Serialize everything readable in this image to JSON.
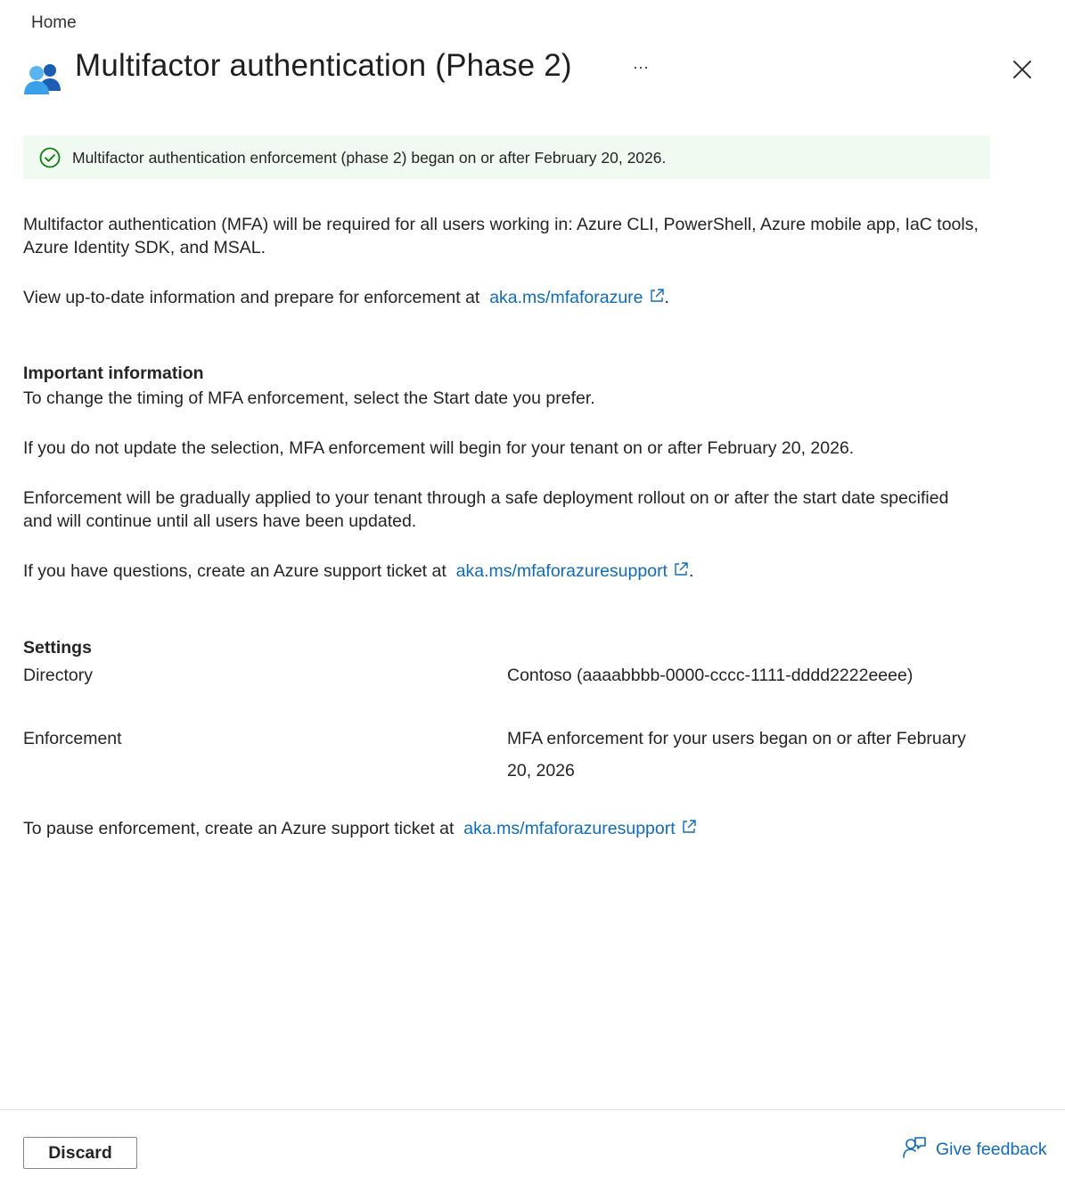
{
  "breadcrumb": {
    "home": "Home"
  },
  "header": {
    "title": "Multifactor authentication (Phase 2)",
    "more": "···",
    "icon": "users-icon"
  },
  "banner": {
    "icon": "check-circle-icon",
    "text": "Multifactor authentication enforcement (phase 2) began on or after February 20, 2026."
  },
  "intro": {
    "p1": "Multifactor authentication (MFA) will be required for all users working in: Azure CLI, PowerShell, Azure mobile app, IaC tools, Azure Identity SDK, and MSAL.",
    "p2_text": "View up-to-date information and prepare for enforcement at",
    "p2_link": "aka.ms/mfaforazure",
    "p2_suffix": "."
  },
  "important": {
    "heading": "Important information",
    "p1": "To change the timing of MFA enforcement, select the Start date you prefer.",
    "p2": "If you do not update the selection, MFA enforcement will begin for your tenant on or after February 20, 2026.",
    "p3": "Enforcement will be gradually applied to your tenant through a safe deployment rollout on or after the start date specified and will continue until all users have been updated.",
    "p4_text": "If you have questions, create an Azure support ticket at",
    "p4_link": "aka.ms/mfaforazuresupport",
    "p4_suffix": "."
  },
  "settings": {
    "heading": "Settings",
    "directory_label": "Directory",
    "directory_value": "Contoso (aaaabbbb-0000-cccc-1111-dddd2222eeee)",
    "enforcement_label": "Enforcement",
    "enforcement_value": "MFA enforcement for your users began on or after February 20, 2026",
    "pause_text": "To pause enforcement, create an Azure support ticket at",
    "pause_link": "aka.ms/mfaforazuresupport"
  },
  "footer": {
    "discard": "Discard",
    "feedback": "Give feedback"
  },
  "colors": {
    "link": "#0f6cbd",
    "banner_bg": "#f1faf1",
    "success": "#107c10"
  }
}
